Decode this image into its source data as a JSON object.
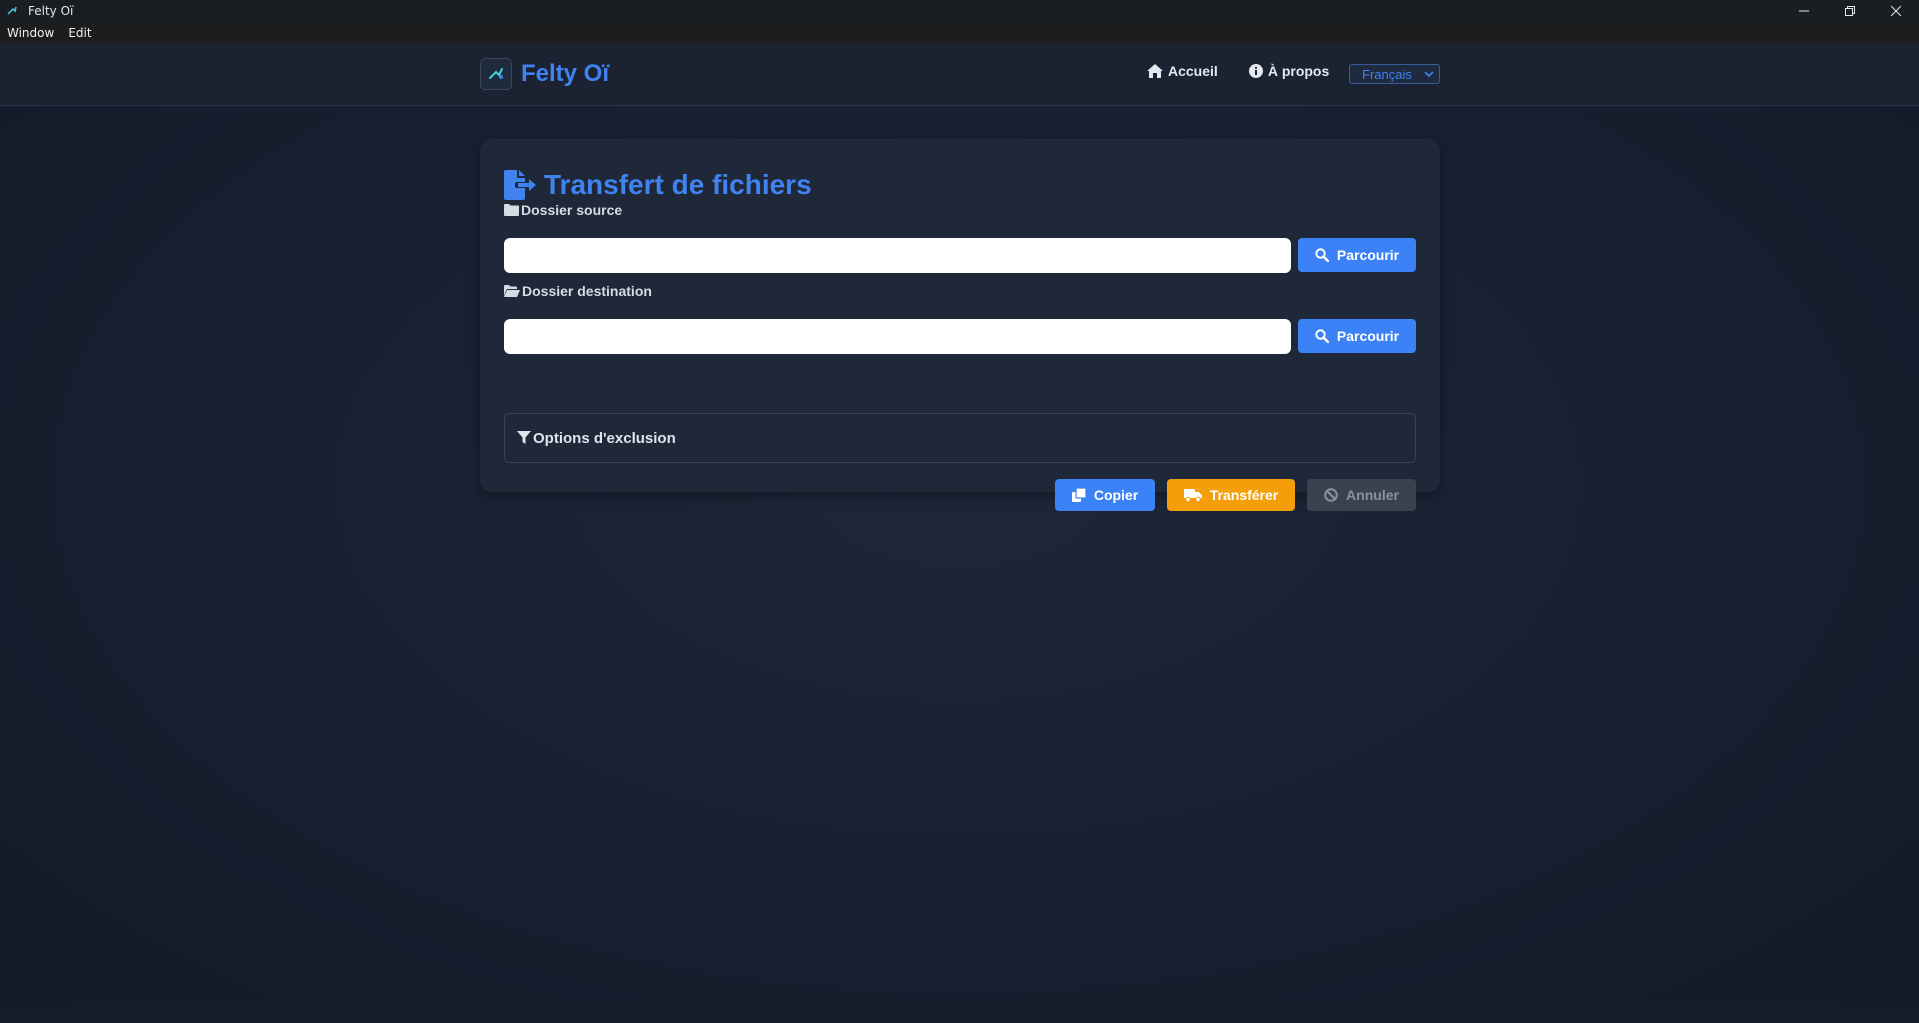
{
  "window": {
    "title": "Felty Oï",
    "controls": [
      "minimize",
      "restore",
      "close"
    ]
  },
  "menubar": {
    "items": [
      "Window",
      "Edit"
    ]
  },
  "navbar": {
    "brand": "Felty Oï",
    "links": [
      {
        "label": "Accueil",
        "icon": "home-icon"
      },
      {
        "label": "À propos",
        "icon": "info-icon"
      }
    ],
    "language": {
      "selected": "Français"
    }
  },
  "main": {
    "title": "Transfert de fichiers",
    "source": {
      "label": "Dossier source",
      "value": "",
      "browse_label": "Parcourir"
    },
    "destination": {
      "label": "Dossier destination",
      "value": "",
      "browse_label": "Parcourir"
    },
    "exclusion_label": "Options d'exclusion",
    "actions": {
      "copy_label": "Copier",
      "transfer_label": "Transférer",
      "cancel_label": "Annuler"
    }
  },
  "colors": {
    "accent": "#3b82f6",
    "warning": "#f59e0b",
    "disabled": "#3a4250",
    "background": "#182032"
  }
}
